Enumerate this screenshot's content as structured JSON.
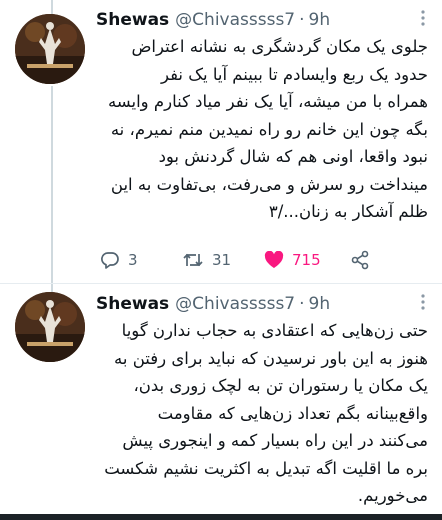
{
  "tweets": [
    {
      "author_name": "Shewas",
      "handle": "@Chivasssss7",
      "separator": "·",
      "time": "9h",
      "more_icon": "more-vertical-icon",
      "lines": [
        "جلوی یک مکان گردشگری به نشانه اعتراض",
        "حدود یک ربع وایسادم تا ببینم آیا یک نفر",
        "همراه با من میشه، آیا یک نفر میاد کنارم وایسه",
        "بگه چون این خانم رو راه نمیدین منم نمیرم، نه",
        "نبود واقعا، اونی هم که شال گردنش بود",
        "مینداخت رو سرش و می‌رفت، بی‌تفاوت به این",
        "ظلم آشکار به زنان.../۳"
      ],
      "actions": {
        "reply_count": "3",
        "retweet_count": "31",
        "like_count": "715"
      }
    },
    {
      "author_name": "Shewas",
      "handle": "@Chivasssss7",
      "separator": "·",
      "time": "9h",
      "more_icon": "more-vertical-icon",
      "lines": [
        "حتی زن‌هایی که اعتقادی به حجاب ندارن گویا",
        "هنوز به این باور نرسیدن که نباید برای رفتن به",
        "یک مکان یا رستوران تن به لچک زوری بدن،",
        "واقع‌بینانه بگم تعداد زن‌هایی که مقاومت",
        "می‌کنند در این راه بسیار کمه و اینجوری پیش",
        "بره ما اقلیت اگه تبدیل به اکثریت نشیم شکست",
        "می‌خوریم."
      ]
    }
  ],
  "colors": {
    "like_pink": "#f91880",
    "secondary_text": "#536471",
    "thread_line": "#cfd9de"
  }
}
